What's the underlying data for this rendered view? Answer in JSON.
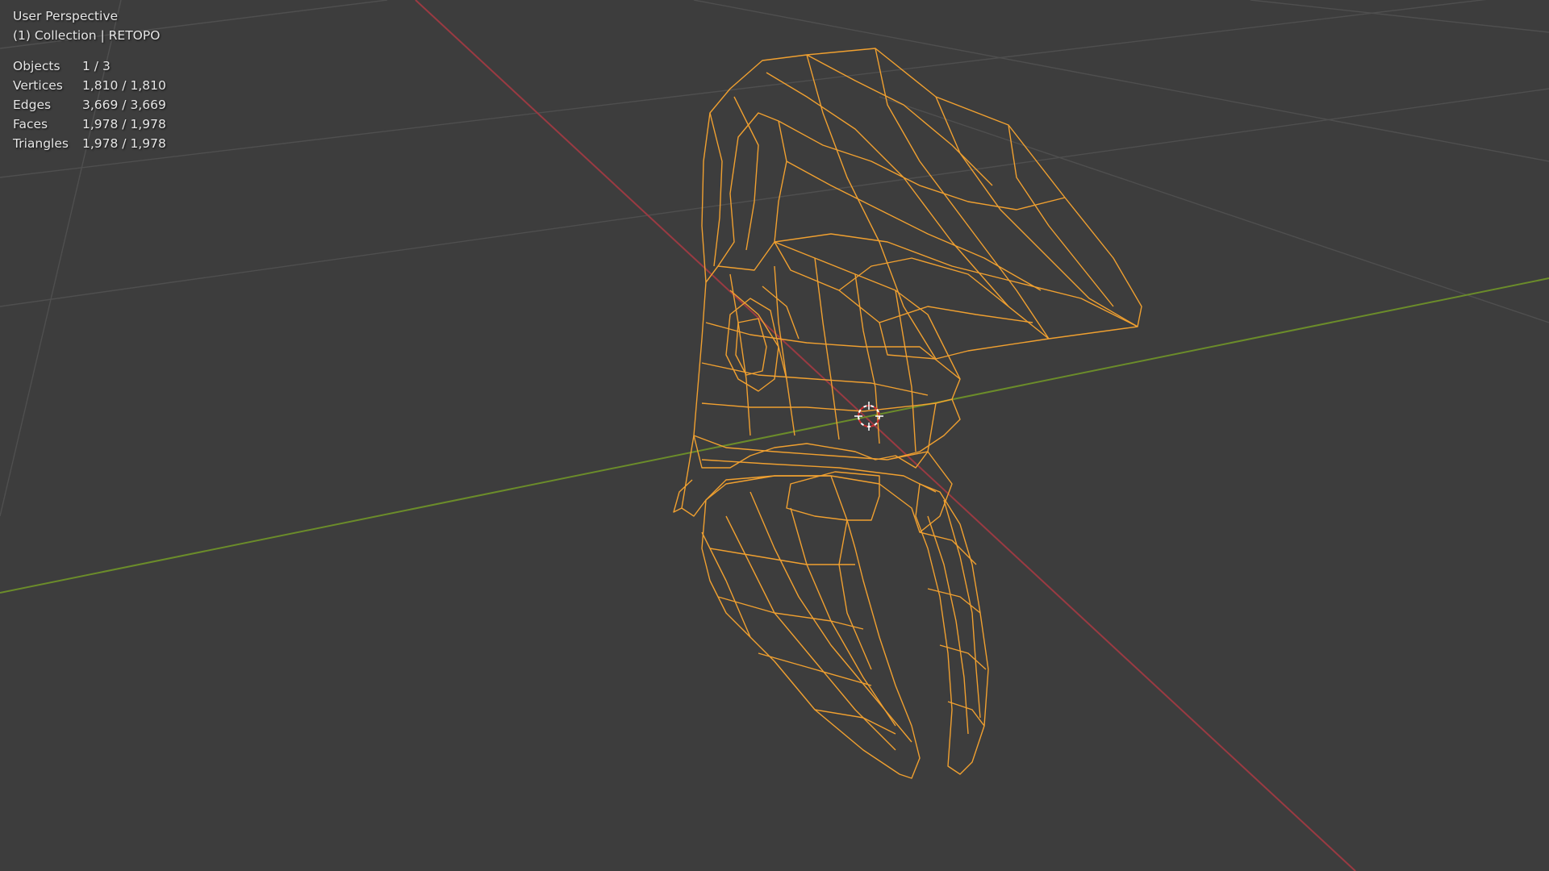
{
  "viewport": {
    "view_name": "User Perspective",
    "collection_line": "(1) Collection | RETOPO",
    "stats": [
      {
        "label": "Objects",
        "value": "1 / 3"
      },
      {
        "label": "Vertices",
        "value": "1,810 / 1,810"
      },
      {
        "label": "Edges",
        "value": "3,669 / 3,669"
      },
      {
        "label": "Faces",
        "value": "1,978 / 1,978"
      },
      {
        "label": "Triangles",
        "value": "1,978 / 1,978"
      }
    ],
    "colors": {
      "background": "#3d3d3d",
      "grid": "#4f4f4f",
      "x_axis": "#9a3a42",
      "y_axis": "#6b8c2a",
      "wireframe": "#f0a030",
      "origin_cursor": "#ffffff"
    },
    "object": {
      "name": "RETOPO",
      "display": "wireframe",
      "selected": true
    }
  }
}
